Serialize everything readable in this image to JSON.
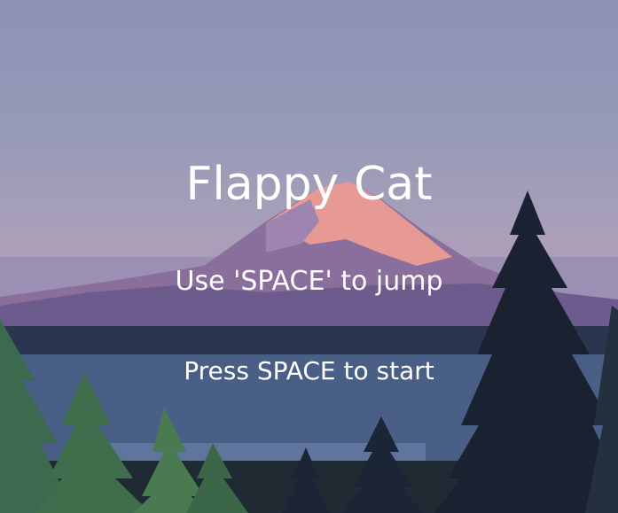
{
  "game": {
    "title": "Flappy Cat",
    "instruction": "Use 'SPACE' to jump",
    "start_prompt": "Press SPACE to start"
  },
  "colors": {
    "sky_top": "#8c93b5",
    "mountain_lit": "#e79a94",
    "mountain_shadow": "#8a6e9b",
    "lake": "#4a5f86",
    "forest_dark": "#1c2536",
    "tree_green": "#3c6a4e",
    "text": "#ffffff"
  }
}
